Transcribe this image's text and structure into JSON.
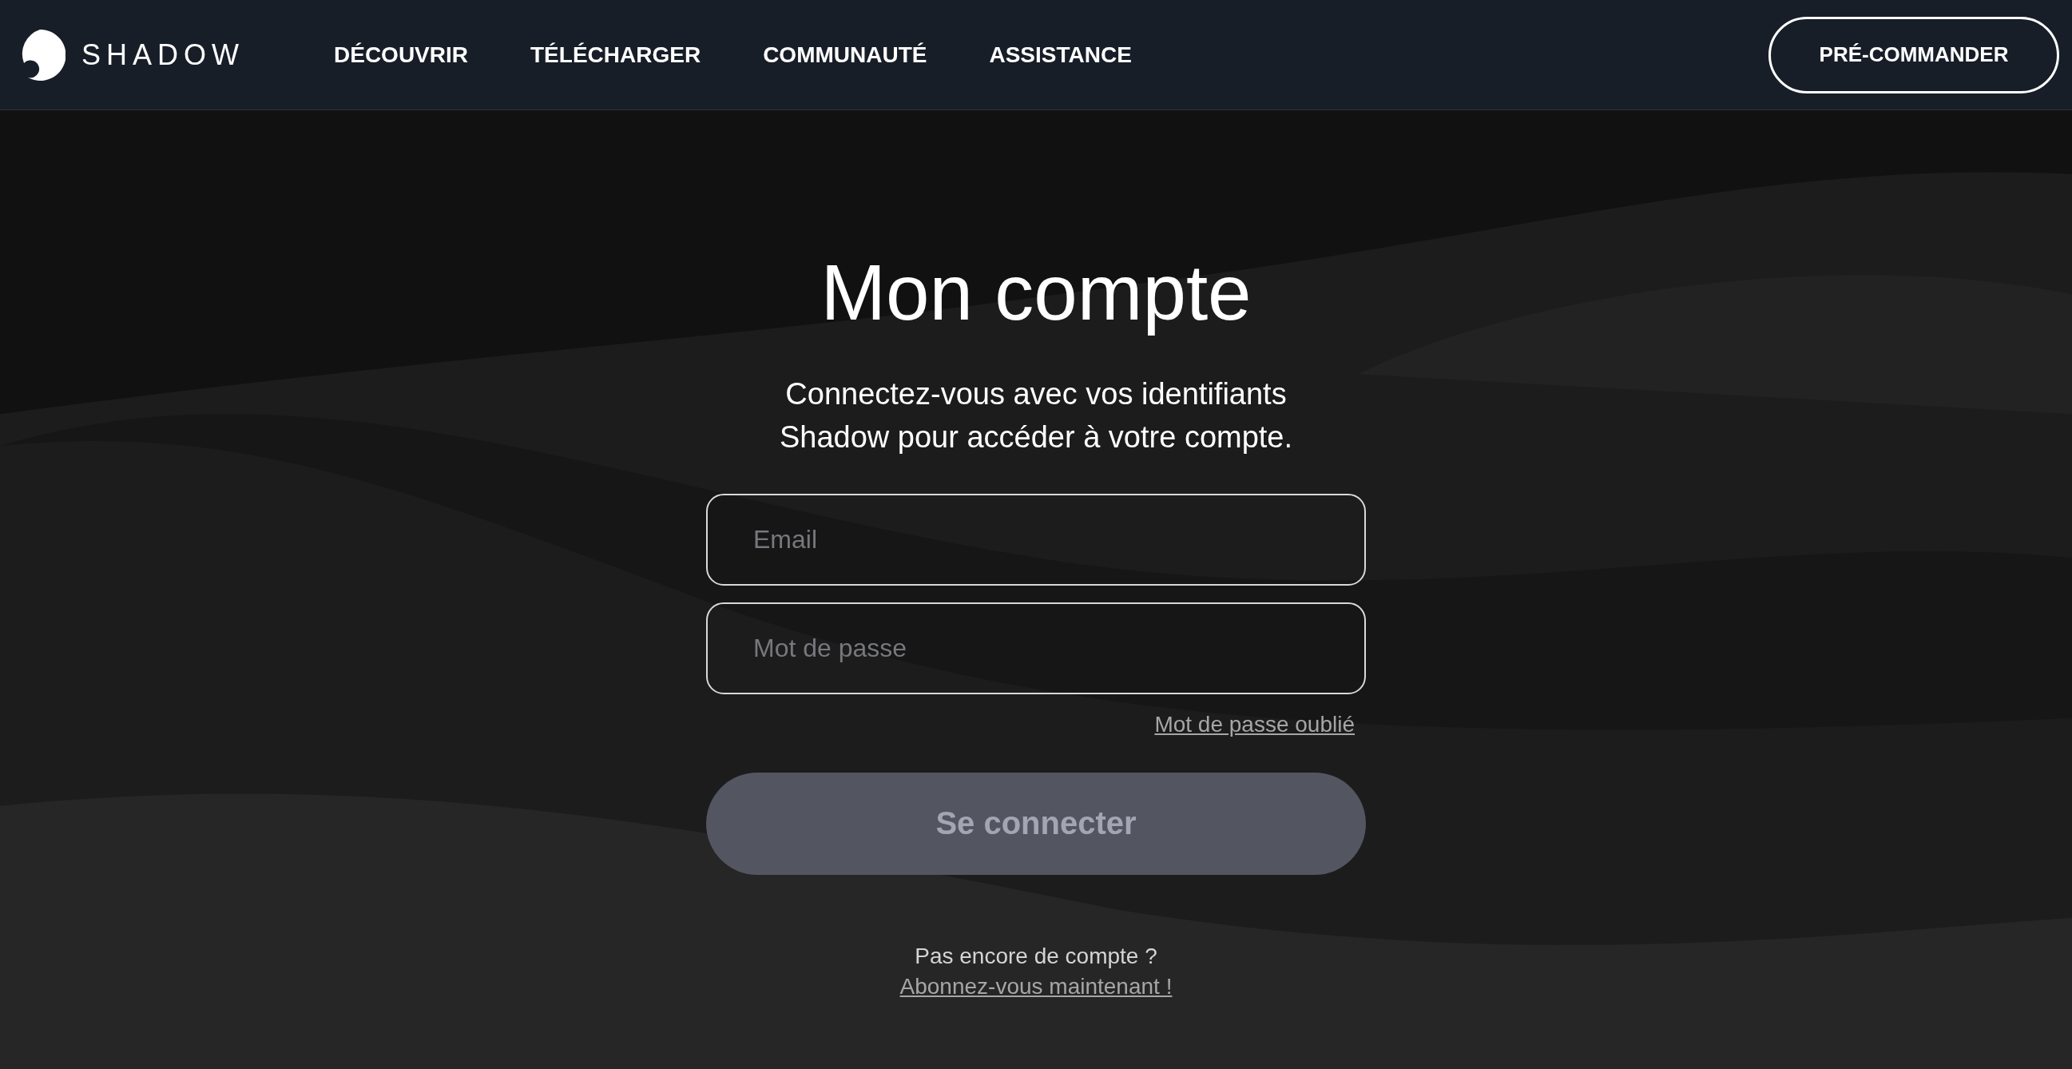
{
  "header": {
    "logo_text": "SHADOW",
    "nav": [
      {
        "label": "DÉCOUVRIR"
      },
      {
        "label": "TÉLÉCHARGER"
      },
      {
        "label": "COMMUNAUTÉ"
      },
      {
        "label": "ASSISTANCE"
      }
    ],
    "cta": "PRÉ-COMMANDER"
  },
  "login": {
    "title": "Mon compte",
    "subtitle": [
      "Connectez-vous avec vos identifiants",
      "Shadow pour accéder à votre compte."
    ],
    "fields": [
      {
        "placeholder": "Email"
      },
      {
        "placeholder": "Mot de passe"
      }
    ],
    "forgot_link": "Mot de passe oublié",
    "submit": {
      "label": "Se connecter",
      "disabled": true
    },
    "signup_prompt": "Pas encore de compte ?",
    "signup_link": "Abonnez-vous maintenant !"
  }
}
